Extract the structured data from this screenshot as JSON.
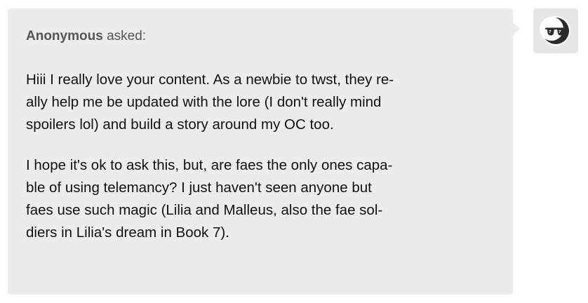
{
  "ask": {
    "asker_name": "Anonymous",
    "asked_verb": "asked:",
    "paragraphs": [
      {
        "lines": [
          "Hiii I really love your content. As a newbie to twst, they re-",
          "ally help me be updated with the lore (I don't really mind",
          "spoilers lol) and build a story around my OC too."
        ]
      },
      {
        "lines": [
          "I hope it's ok to ask this, but, are faes the only ones capa-",
          "ble of using telemancy? I just haven't seen anyone but",
          "faes use such magic (Lilia and Malleus, also the fae sol-",
          "diers in Lilia's dream in Book 7)."
        ]
      }
    ]
  },
  "avatar": {
    "icon": "sunglasses-moon-avatar-icon",
    "background_color": "#e6e6e6"
  },
  "colors": {
    "bubble_background": "#ececec",
    "body_text": "#111111",
    "header_text": "#555555"
  }
}
